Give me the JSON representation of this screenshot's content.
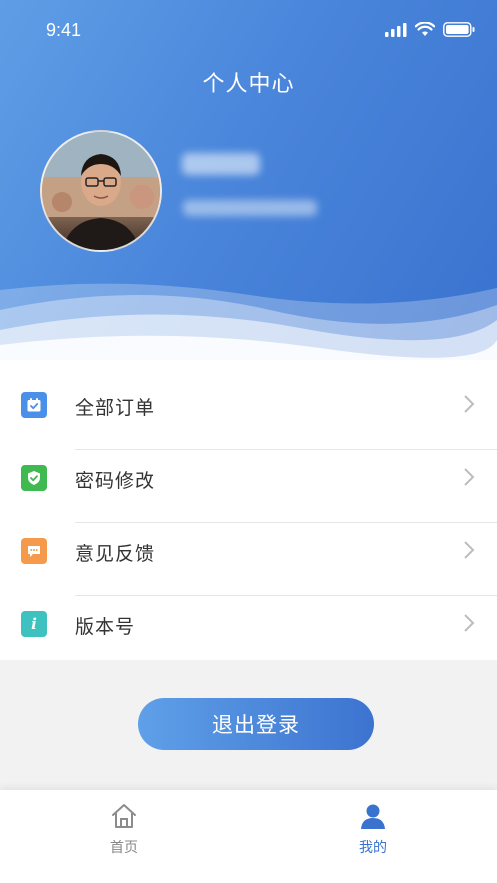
{
  "status_bar": {
    "time": "9:41"
  },
  "header": {
    "title": "个人中心"
  },
  "menu": {
    "items": [
      {
        "label": "全部订单",
        "icon": "calendar-check-icon",
        "color": "#4a90e8"
      },
      {
        "label": "密码修改",
        "icon": "shield-check-icon",
        "color": "#3fb950"
      },
      {
        "label": "意见反馈",
        "icon": "chat-bubble-icon",
        "color": "#f59a4a"
      },
      {
        "label": "版本号",
        "icon": "info-icon",
        "color": "#3ec2c0"
      }
    ]
  },
  "logout": {
    "label": "退出登录"
  },
  "tabbar": {
    "tabs": [
      {
        "label": "首页",
        "icon": "home-icon",
        "active": false
      },
      {
        "label": "我的",
        "icon": "user-icon",
        "active": true
      }
    ]
  },
  "colors": {
    "accent": "#3a72cf",
    "inactive": "#888888"
  }
}
